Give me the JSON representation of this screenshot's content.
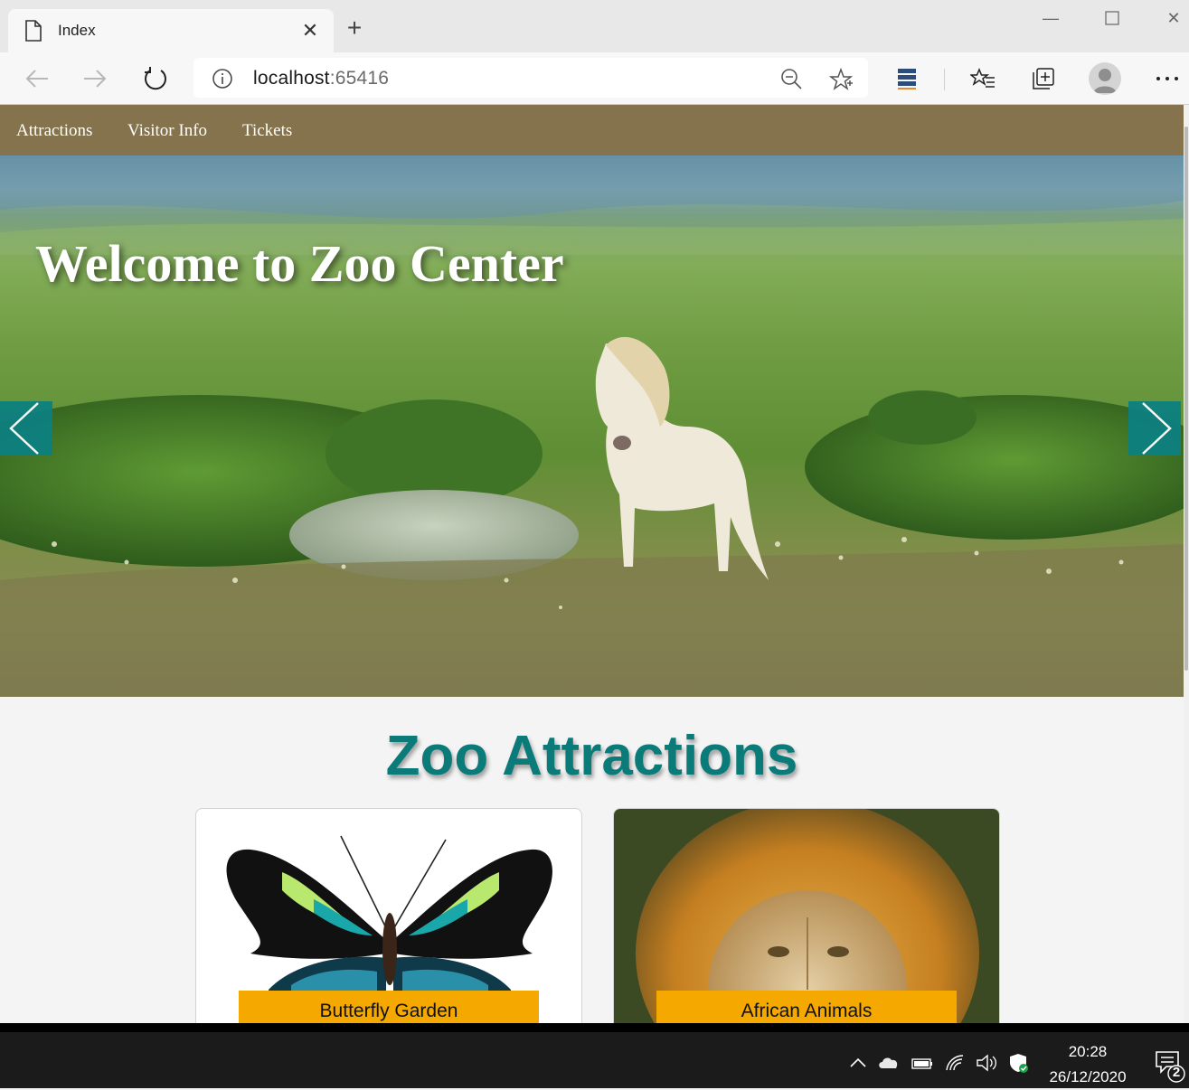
{
  "browser": {
    "tab_title": "Index",
    "address_host": "localhost",
    "address_port": ":65416"
  },
  "site": {
    "nav": [
      "Attractions",
      "Visitor Info",
      "Tickets"
    ],
    "hero_title": "Welcome to Zoo Center",
    "section_title": "Zoo Attractions",
    "cards": [
      {
        "label": "Butterfly Garden"
      },
      {
        "label": "African Animals"
      }
    ]
  },
  "taskbar": {
    "time": "20:28",
    "date": "26/12/2020",
    "notification_count": "2"
  },
  "colors": {
    "nav_bg": "#84734c",
    "accent_teal": "#0b7b7a",
    "label_orange": "#f5a800"
  },
  "icons": [
    "page-icon",
    "close-icon",
    "plus-icon",
    "minimize-icon",
    "maximize-icon",
    "back-icon",
    "forward-icon",
    "refresh-icon",
    "info-icon",
    "zoom-icon",
    "star-icon",
    "database-icon",
    "favorites-icon",
    "collections-icon",
    "profile-icon",
    "more-icon",
    "chevron-left-icon",
    "chevron-right-icon",
    "chevron-up-icon",
    "cloud-icon",
    "battery-icon",
    "wifi-icon",
    "volume-icon",
    "shield-icon",
    "notification-icon"
  ]
}
